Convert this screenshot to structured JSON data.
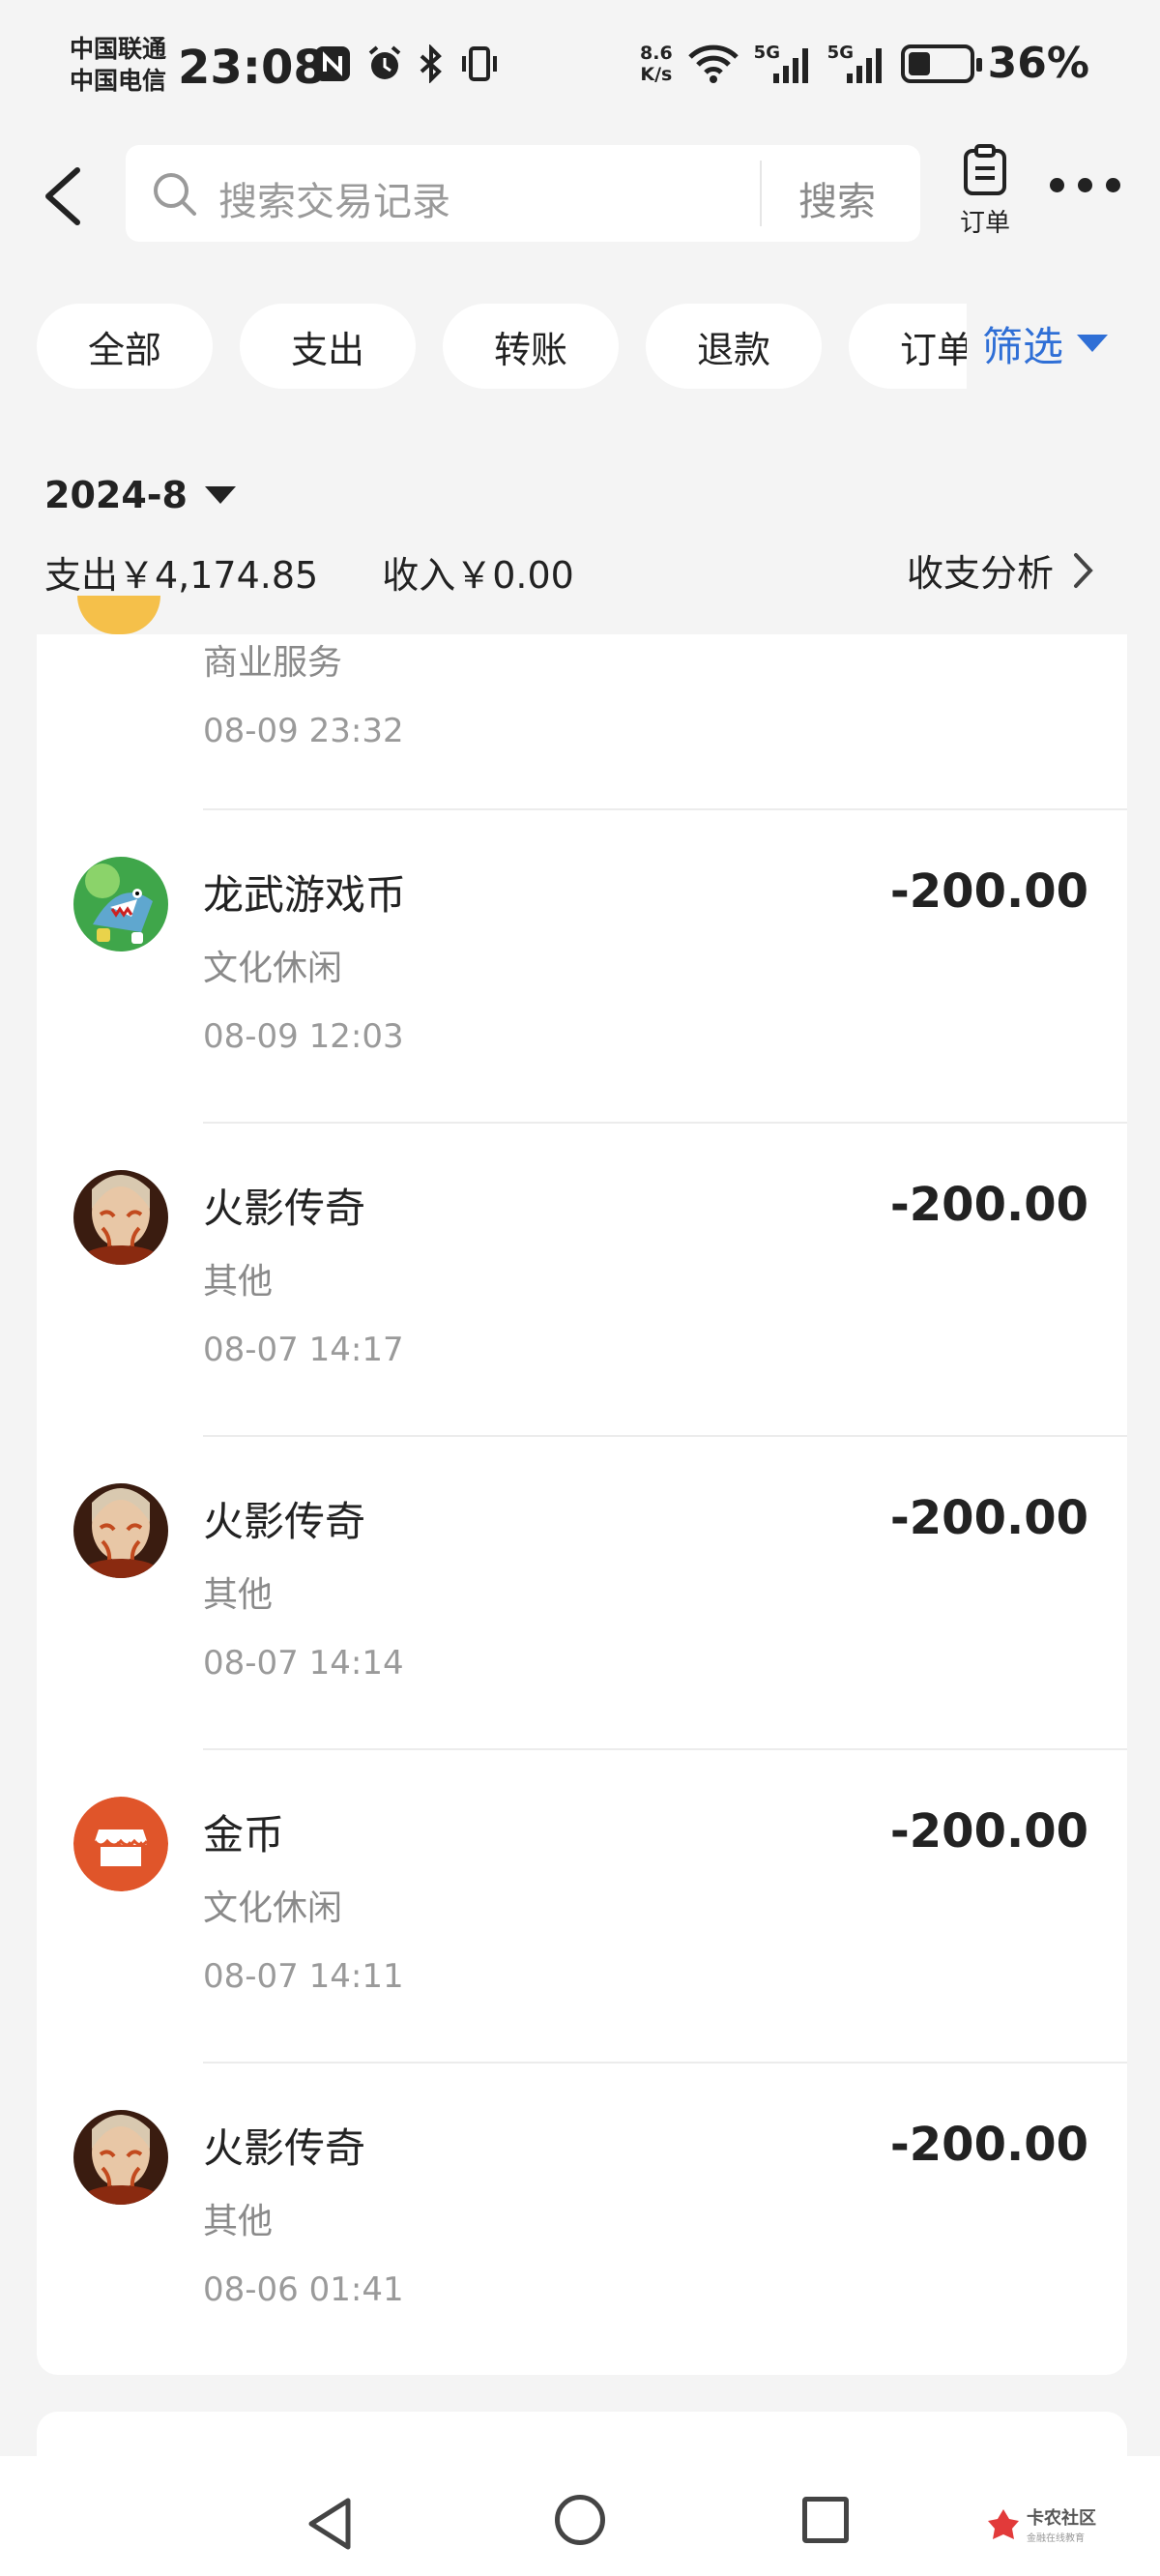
{
  "status_bar": {
    "carrier1": "中国联通",
    "carrier2": "中国电信",
    "time": "23:08",
    "speed_top": "8.6",
    "speed_bottom": "K/s",
    "net1": "5G",
    "net2": "5G",
    "battery_percent": "36%",
    "battery_level": 0.36
  },
  "header": {
    "search_placeholder": "搜索交易记录",
    "search_button": "搜索",
    "orders_label": "订单"
  },
  "filters": {
    "chips": [
      "全部",
      "支出",
      "转账",
      "退款",
      "订单"
    ],
    "filter_label": "筛选",
    "accent_color": "#2f6fd6"
  },
  "summary": {
    "month": "2024-8",
    "expense": "支出￥4,174.85",
    "income": "收入￥0.00",
    "analysis": "收支分析"
  },
  "partial_item": {
    "category": "商业服务",
    "time": "08-09 23:32"
  },
  "transactions": [
    {
      "title": "龙武游戏币",
      "category": "文化休闲",
      "time": "08-09 12:03",
      "amount": "-200.00",
      "avatar": "game-shark-avatar"
    },
    {
      "title": "火影传奇",
      "category": "其他",
      "time": "08-07 14:17",
      "amount": "-200.00",
      "avatar": "character-avatar"
    },
    {
      "title": "火影传奇",
      "category": "其他",
      "time": "08-07 14:14",
      "amount": "-200.00",
      "avatar": "character-avatar"
    },
    {
      "title": "金币",
      "category": "文化休闲",
      "time": "08-07 14:11",
      "amount": "-200.00",
      "avatar": "shop-avatar"
    },
    {
      "title": "火影传奇",
      "category": "其他",
      "time": "08-06 01:41",
      "amount": "-200.00",
      "avatar": "character-avatar"
    }
  ],
  "watermark": {
    "name": "卡农社区",
    "sub": "金融在线教育"
  }
}
